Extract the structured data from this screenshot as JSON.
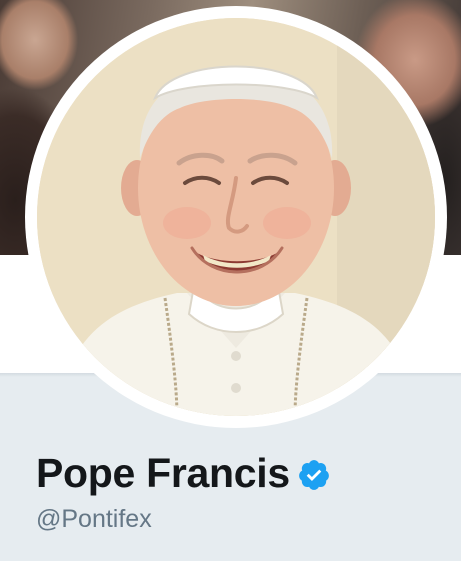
{
  "profile": {
    "display_name": "Pope Francis",
    "handle": "@Pontifex",
    "verified": true
  },
  "icons": {
    "verified_badge": "verified-badge-icon",
    "avatar": "profile-photo",
    "banner": "header-photo"
  },
  "colors": {
    "page_background": "#e6ecf0",
    "name_text": "#14171a",
    "handle_text": "#657786",
    "verified_blue": "#1da1f2"
  }
}
